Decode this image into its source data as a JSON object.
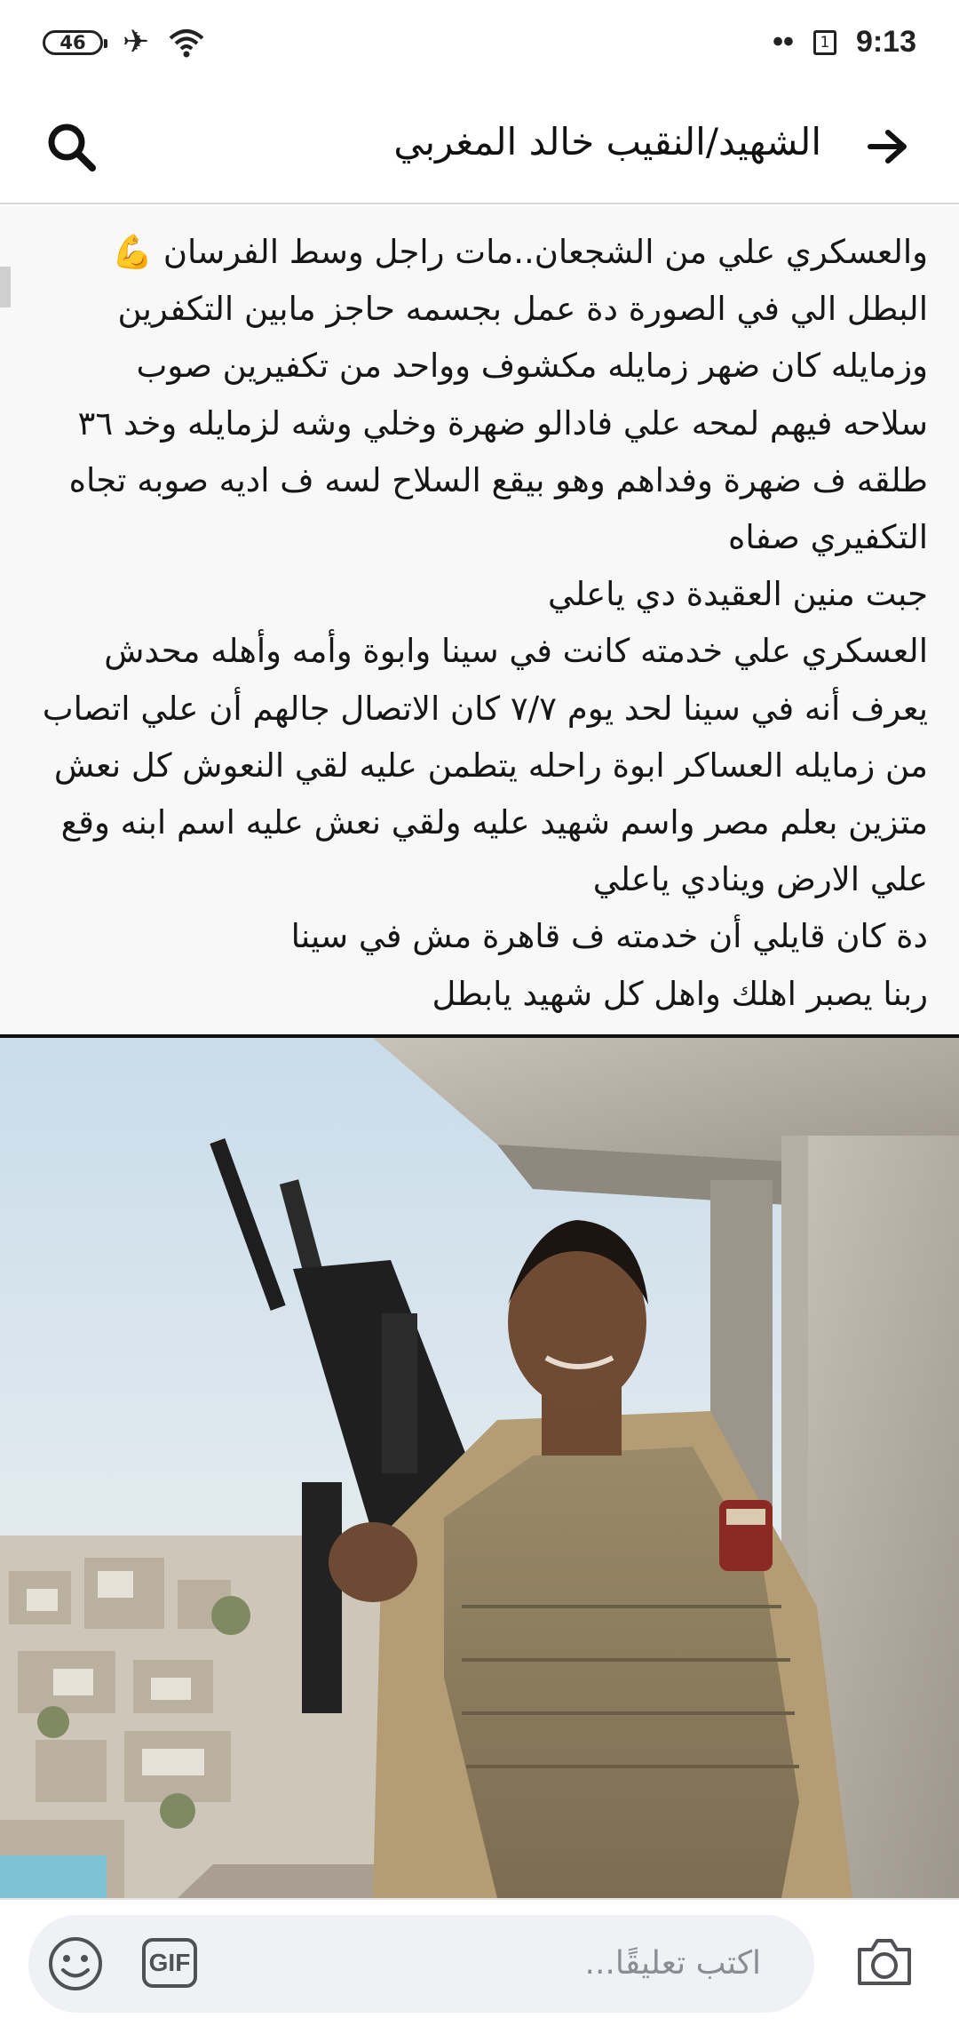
{
  "status_bar": {
    "battery": "46",
    "time": "9:13",
    "sim_slot": "1",
    "dots": "••"
  },
  "header": {
    "title": "الشهيد/النقيب خالد المغربي"
  },
  "post": {
    "lines": [
      "والعسكري علي من الشجعان..مات راجل وسط الفرسان 💪",
      "البطل الي في الصورة دة عمل بجسمه حاجز مابين التكفرين",
      "وزمايله كان ضهر زمايله مكشوف وواحد من تكفيرين صوب",
      "سلاحه فيهم لمحه علي  فادالو ضهرة وخلي وشه لزمايله وخد ٣٦",
      "طلقه ف ضهرة وفداهم وهو بيقع السلاح لسه ف اديه صوبه تجاه",
      "التكفيري صفاه",
      "جبت منين العقيدة دي ياعلي",
      "العسكري علي خدمته كانت في سينا وابوة وأمه وأهله محدش",
      "يعرف أنه في سينا لحد يوم ٧/٧ كان الاتصال جالهم أن علي اتصاب",
      "من زمايله العساكر ابوة راحله يتطمن عليه لقي النعوش كل نعش",
      "متزين بعلم مصر واسم شهيد عليه ولقي نعش عليه اسم ابنه وقع",
      "علي الارض وينادي ياعلي",
      "دة كان قايلي أن خدمته ف قاهرة مش في سينا",
      "ربنا يصبر اهلك واهل كل شهيد يابطل"
    ]
  },
  "composer": {
    "placeholder": "اكتب تعليقًا...",
    "gif_label": "GIF"
  },
  "icons": {
    "back": "arrow-right-icon",
    "search": "search-icon",
    "emoji": "smiley-icon",
    "camera": "camera-icon"
  }
}
